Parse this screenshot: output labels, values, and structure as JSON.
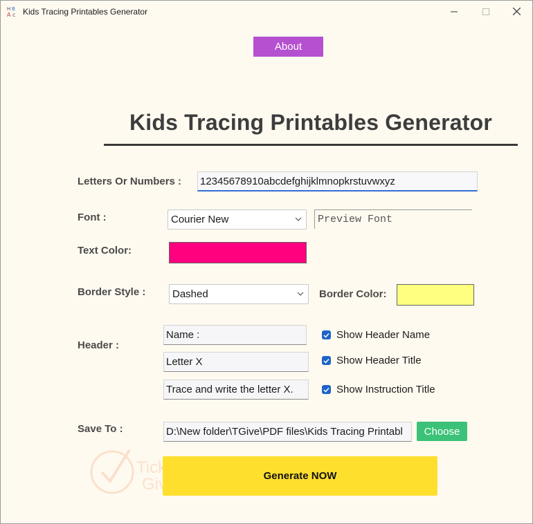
{
  "window": {
    "title": "Kids Tracing Printables Generator",
    "icon": "abc-app-icon"
  },
  "about_label": "About",
  "heading": "Kids Tracing Printables Generator",
  "letters": {
    "label": "Letters Or Numbers :",
    "value": "12345678910abcdefghijklmnopkrstuvwxyz"
  },
  "font": {
    "label": "Font :",
    "selected": "Courier New",
    "preview": "Preview Font"
  },
  "text_color": {
    "label": "Text Color:",
    "color": "#ff007f"
  },
  "border": {
    "style_label": "Border Style :",
    "style_selected": "Dashed",
    "color_label": "Border Color:",
    "color": "#ffff80"
  },
  "header": {
    "label": "Header :",
    "name_value": "Name :",
    "title_value": "Letter X",
    "instruction_value": "Trace and write the letter X.",
    "show_name_label": "Show Header Name",
    "show_title_label": "Show Header Title",
    "show_instruction_label": "Show Instruction Title",
    "show_name": true,
    "show_title": true,
    "show_instruction": true
  },
  "save": {
    "label": "Save To :",
    "path": "D:\\New folder\\TGive\\PDF files\\Kids Tracing Printabl",
    "choose_label": "Choose"
  },
  "generate_label": "Generate NOW",
  "watermark": {
    "line1": "Tickcoupon",
    "line2": "Giveaway"
  },
  "colors": {
    "background": "#fffaf0",
    "about_button": "#b551d0",
    "choose_button": "#3cc278",
    "generate_button": "#ffdf2e",
    "checkbox": "#1e64c8"
  }
}
